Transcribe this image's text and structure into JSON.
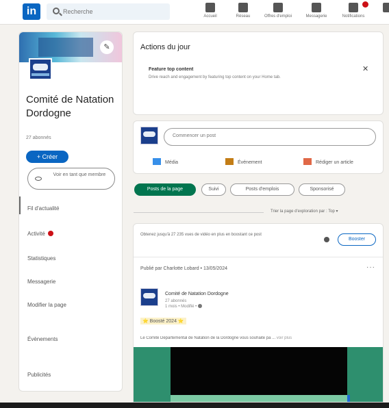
{
  "nav": {
    "search_placeholder": "Recherche",
    "items": [
      {
        "label": "Accueil",
        "icon": "home-icon"
      },
      {
        "label": "Réseau",
        "icon": "network-icon"
      },
      {
        "label": "Offres d'emploi",
        "icon": "briefcase-icon"
      },
      {
        "label": "Messagerie",
        "icon": "messaging-icon"
      },
      {
        "label": "Notifications",
        "icon": "bell-icon"
      }
    ]
  },
  "page": {
    "name": "Comité de Natation Dordogne",
    "followers": "27 abonnés",
    "create_label": "+ Créer",
    "invite_label": "Voir en tant que membre"
  },
  "sidebar": {
    "items": [
      {
        "label": "Fil d'actualité"
      },
      {
        "label": "Activité"
      },
      {
        "label": "Statistiques"
      },
      {
        "label": "Messagerie"
      },
      {
        "label": "Modifier la page"
      },
      {
        "label": "Évènements"
      },
      {
        "label": "Publicités"
      }
    ]
  },
  "actions": {
    "title": "Actions du jour",
    "item_title": "Feature top content",
    "item_desc": "Drive reach and engagement by featuring top content on your Home tab."
  },
  "composer": {
    "placeholder": "Commencer un post",
    "media_label": "Média",
    "event_label": "Événement",
    "article_label": "Rédiger un article"
  },
  "tabs": [
    {
      "label": "Posts de la page"
    },
    {
      "label": "Suivi"
    },
    {
      "label": "Posts d'emplois"
    },
    {
      "label": "Sponsorisé"
    }
  ],
  "sort": {
    "label": "Trier la page d'exploration par : Top ▾"
  },
  "feed": {
    "promo_text": "Obtenez jusqu'à 27 235 vues de vidéo en plus en boostant ce post",
    "boost_label": "Booster",
    "posted_by": "Publié par Charlotte Lobard • 13/05/2024",
    "org_name": "Comité de Natation Dordogne",
    "org_followers": "27 abonnés",
    "org_meta": "1 mois • Modifié •",
    "boosted_label": "⭐ Boosté 2024 ⭐",
    "post_text": "Le Comité Départemental de Natation de la Dordogne vous souhaite pa ...",
    "see_more": "voir plus"
  },
  "colors": {
    "brand": "#0a66c2",
    "active_chip": "#01754f",
    "badge": "#cc1016"
  }
}
